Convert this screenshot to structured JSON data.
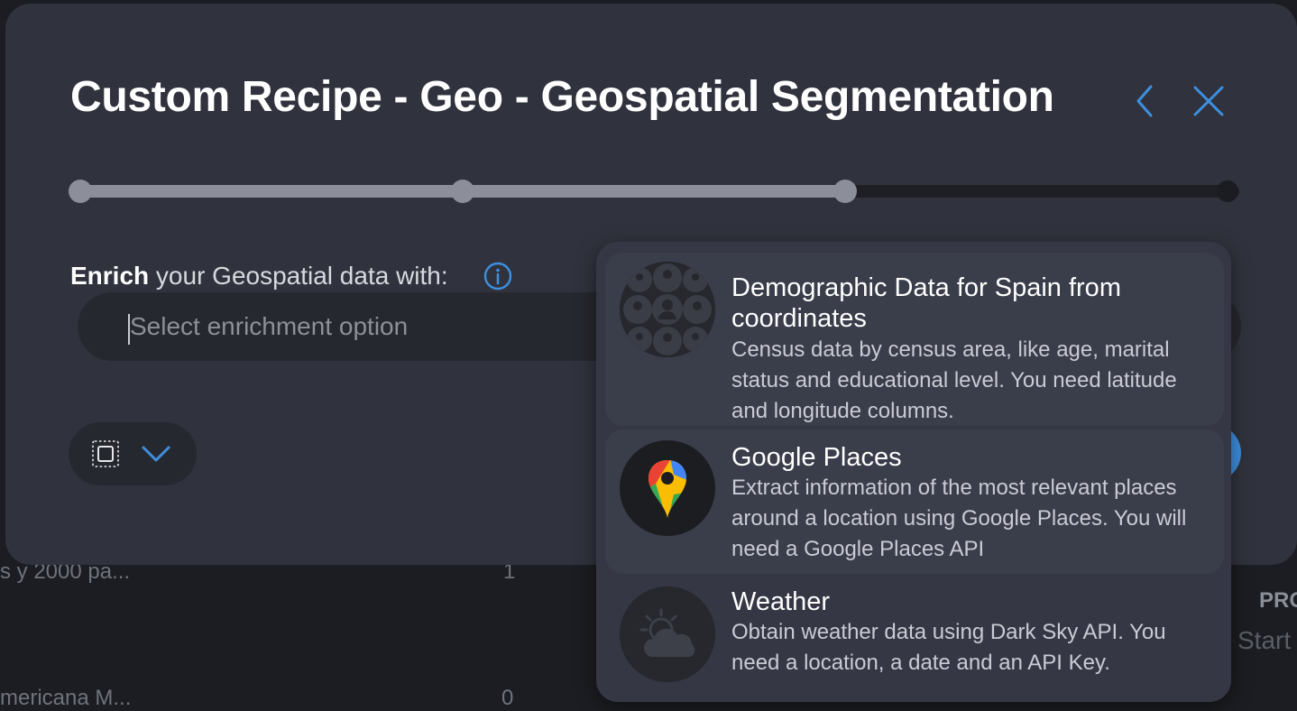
{
  "background": {
    "row1_name": "s y 2000 pa...",
    "row1_count": "1",
    "row2_name": "mericana M...",
    "row2_count": "0",
    "col_header": "PRO",
    "col_value": "Start"
  },
  "modal": {
    "title": "Custom Recipe - Geo - Geospatial Segmentation",
    "back_icon": "chevron-left-icon",
    "close_icon": "close-icon",
    "progress": {
      "steps": 4,
      "completed_step": 3
    },
    "enrich_label_bold": "Enrich",
    "enrich_label_rest": " your Geospatial data with:",
    "info_icon": "info-icon",
    "select": {
      "placeholder": "Select enrichment option"
    },
    "tools": {
      "selection_icon": "selection-icon",
      "expand_icon": "chevron-down-icon"
    }
  },
  "dropdown": {
    "options": [
      {
        "title": "Demographic Data for Spain from coordinates",
        "description": "Census data by census area, like age, marital status and educational level. You need latitude and longitude columns.",
        "icon": "people-icon"
      },
      {
        "title": "Google Places",
        "description": "Extract information of the most relevant places around a location using Google Places. You will need a Google Places API",
        "icon": "google-maps-pin-icon"
      },
      {
        "title": "Weather",
        "description": "Obtain weather data using Dark Sky API. You need a location, a date and an API Key.",
        "icon": "weather-icon"
      }
    ]
  },
  "colors": {
    "accent": "#3d8fe0",
    "modal_bg": "#30333d",
    "dropdown_bg": "#353844"
  }
}
